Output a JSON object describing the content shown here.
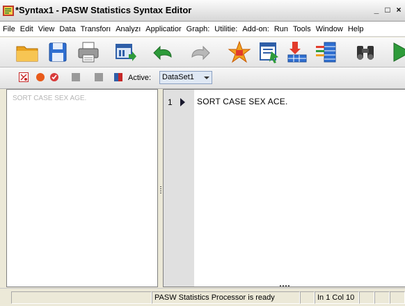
{
  "window": {
    "title": "*Syntax1 - PASW Statistics Syntax Editor",
    "buttons": {
      "minimize": "_",
      "restore": "□",
      "close": "×"
    }
  },
  "menu": [
    "File",
    "Edit",
    "View",
    "Data",
    "Transforı",
    "Analyzı",
    "Applicatior",
    "Graph:",
    "Utilitie:",
    "Add-on:",
    "Run",
    "Tools",
    "Window",
    "Help"
  ],
  "toolbar": {
    "icons": [
      "open-folder-icon",
      "save-icon",
      "print-icon",
      "recall-dialog-icon",
      "undo-icon",
      "redo-icon",
      "bookmark-star-icon",
      "goto-variable-icon",
      "goto-case-icon",
      "variables-icon",
      "find-binoculars-icon",
      "run-icon"
    ]
  },
  "toolbar2": {
    "icons": [
      "toggle-breakpoint-icon",
      "clear-breakpoints-icon",
      "step-through-icon",
      "inactive-icon-1",
      "inactive-icon-2",
      "book-icon"
    ],
    "active_label": "Active:",
    "active_dataset": "DataSet1"
  },
  "navigator": {
    "items": [
      "SORT CASE SEX AGE."
    ]
  },
  "editor": {
    "lines": [
      {
        "number": "1",
        "text": "SORT CASE SEX ACE."
      }
    ]
  },
  "status": {
    "cells": [
      "",
      "PASW Statistics Processor is ready",
      "",
      "In 1 Col 10",
      "",
      "",
      ""
    ]
  },
  "colors": {
    "gutter": "#e0e0e0",
    "dataset_select_bg": "#dfe8f4",
    "nav_text": "#b5b5b5"
  }
}
